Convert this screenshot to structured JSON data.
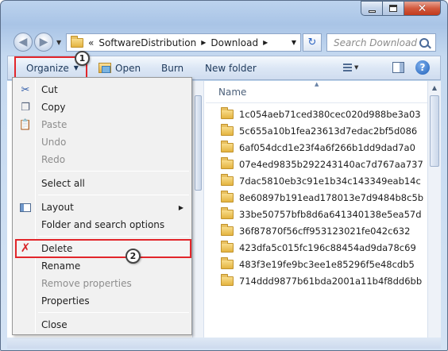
{
  "window": {
    "caption_close": "✕"
  },
  "nav": {
    "back_glyph": "◀",
    "forward_glyph": "▶",
    "breadcrumb_prefix": "«",
    "breadcrumbs": [
      "SoftwareDistribution",
      "Download"
    ],
    "refresh_glyph": "↻",
    "search_placeholder": "Search Download"
  },
  "toolbar": {
    "organize_label": "Organize",
    "open_label": "Open",
    "burn_label": "Burn",
    "new_folder_label": "New folder",
    "help_label": "?"
  },
  "columns": {
    "name_label": "Name"
  },
  "files": [
    "1c054aeb71ced380cec020d988be3a03",
    "5c655a10b1fea23613d7edac2bf5d086",
    "6af054dcd1e23f4a6f266b1dd9dad7a0",
    "07e4ed9835b292243140ac7d767aa737",
    "7dac5810eb3c91e1b34c143349eab14c",
    "8e60897b191ead178013e7d9484b8c5b",
    "33be50757bfb8d6a641340138e5ea57d",
    "36f87870f56cff953123021fe042c632",
    "423dfa5c015fc196c88454ad9da78c69",
    "483f3e19fe9bc3ee1e85296f5e48cdb5",
    "714ddd9877b61bda2001a11b4f8dd6bb"
  ],
  "menu": {
    "cut": "Cut",
    "copy": "Copy",
    "paste": "Paste",
    "undo": "Undo",
    "redo": "Redo",
    "select_all": "Select all",
    "layout": "Layout",
    "folder_options": "Folder and search options",
    "delete": "Delete",
    "rename": "Rename",
    "remove_properties": "Remove properties",
    "properties": "Properties",
    "close": "Close"
  },
  "callouts": {
    "one": "1",
    "two": "2"
  },
  "colors": {
    "highlight_red": "#e2262b",
    "window_frame": "#a9c4e6",
    "folder_yellow": "#e4b440"
  },
  "icons": {
    "cut": "scissors-icon",
    "copy": "copy-icon",
    "paste": "paste-icon",
    "layout": "layout-icon",
    "delete": "delete-x-icon",
    "open": "open-icon",
    "views": "views-icon",
    "preview_pane": "preview-pane-icon",
    "help": "help-icon",
    "search": "search-icon",
    "folder": "folder-icon"
  }
}
